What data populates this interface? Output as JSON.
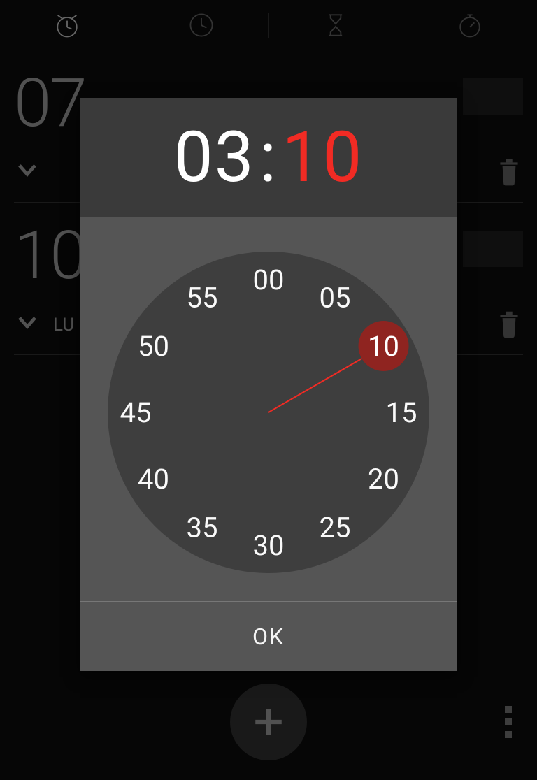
{
  "tabs": {
    "items": [
      "alarm",
      "clock",
      "timer",
      "stopwatch"
    ],
    "active_index": 0
  },
  "alarms": [
    {
      "time": "07",
      "sub": "",
      "trash": true
    },
    {
      "time": "10",
      "sub": "LU",
      "trash": true
    }
  ],
  "picker": {
    "hours": "03",
    "minutes": "10",
    "selected_minute_index": 2,
    "minute_labels": [
      "00",
      "05",
      "10",
      "15",
      "20",
      "25",
      "30",
      "35",
      "40",
      "45",
      "50",
      "55"
    ],
    "ok_label": "OK"
  },
  "bottom": {
    "fab_icon": "plus",
    "overflow_icon": "more"
  }
}
